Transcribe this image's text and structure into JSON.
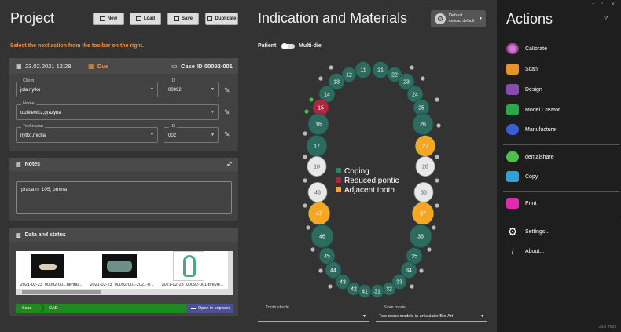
{
  "project": {
    "title": "Project",
    "toolbar": {
      "new": "New",
      "load": "Load",
      "save": "Save",
      "duplicate": "Duplicate"
    },
    "hint": "Select the next action from the toolbar on the right.",
    "case": {
      "date": "23.02.2021 12:28",
      "status": "Due",
      "case_id_label": "Case ID",
      "case_id": "00092-001"
    },
    "client": {
      "label": "Client",
      "value": "jola nytko",
      "id_label": "ID",
      "id_value": "00092"
    },
    "name": {
      "label": "Name",
      "value": "tuzikiewicz,grazyna"
    },
    "technician": {
      "label": "Technician",
      "value": "nytko,michal",
      "id_label": "ID",
      "id_value": "002"
    },
    "notes": {
      "title": "Notes",
      "text": "praca nr 105, pmma"
    },
    "data_status": {
      "title": "Data and status",
      "files": [
        "2021-02-23_00092-001.dental...",
        "2021-02-23_00092-001-2021-0...",
        "2021-02-23_00092-001-previe..."
      ],
      "steps": [
        "Scan",
        "CAD"
      ],
      "open_explorer": "Open in explorer"
    }
  },
  "indication": {
    "title": "Indication and Materials",
    "material_select": {
      "line1": "Default",
      "line2": "exocad default"
    },
    "patient_label": "Patient",
    "multidie_label": "Multi-die",
    "legend": [
      {
        "label": "Coping",
        "color": "#2e7d6e"
      },
      {
        "label": "Reduced pontic",
        "color": "#b3243f"
      },
      {
        "label": "Adjacent tooth",
        "color": "#f5a623"
      }
    ],
    "upper_teeth": [
      "11",
      "21",
      "22",
      "23",
      "24",
      "25",
      "26",
      "27",
      "28",
      "12",
      "13",
      "14",
      "15",
      "16",
      "17",
      "18"
    ],
    "lower_teeth": [
      "31",
      "32",
      "33",
      "34",
      "35",
      "36",
      "37",
      "38",
      "41",
      "42",
      "43",
      "44",
      "45",
      "46",
      "47",
      "48"
    ],
    "tooth_shade": {
      "label": "Tooth shade",
      "value": "--"
    },
    "scan_mode": {
      "label": "Scan mode",
      "value": "Two stone models in articulator Bio-Art"
    }
  },
  "actions": {
    "title": "Actions",
    "help": "?",
    "items": [
      "Calibrate",
      "Scan",
      "Design",
      "Model Creator",
      "Manufacture"
    ],
    "items2": [
      "dentalshare",
      "Copy"
    ],
    "items3": [
      "Print"
    ],
    "items4": [
      "Settings...",
      "About..."
    ],
    "version": "v3.0-7662"
  }
}
